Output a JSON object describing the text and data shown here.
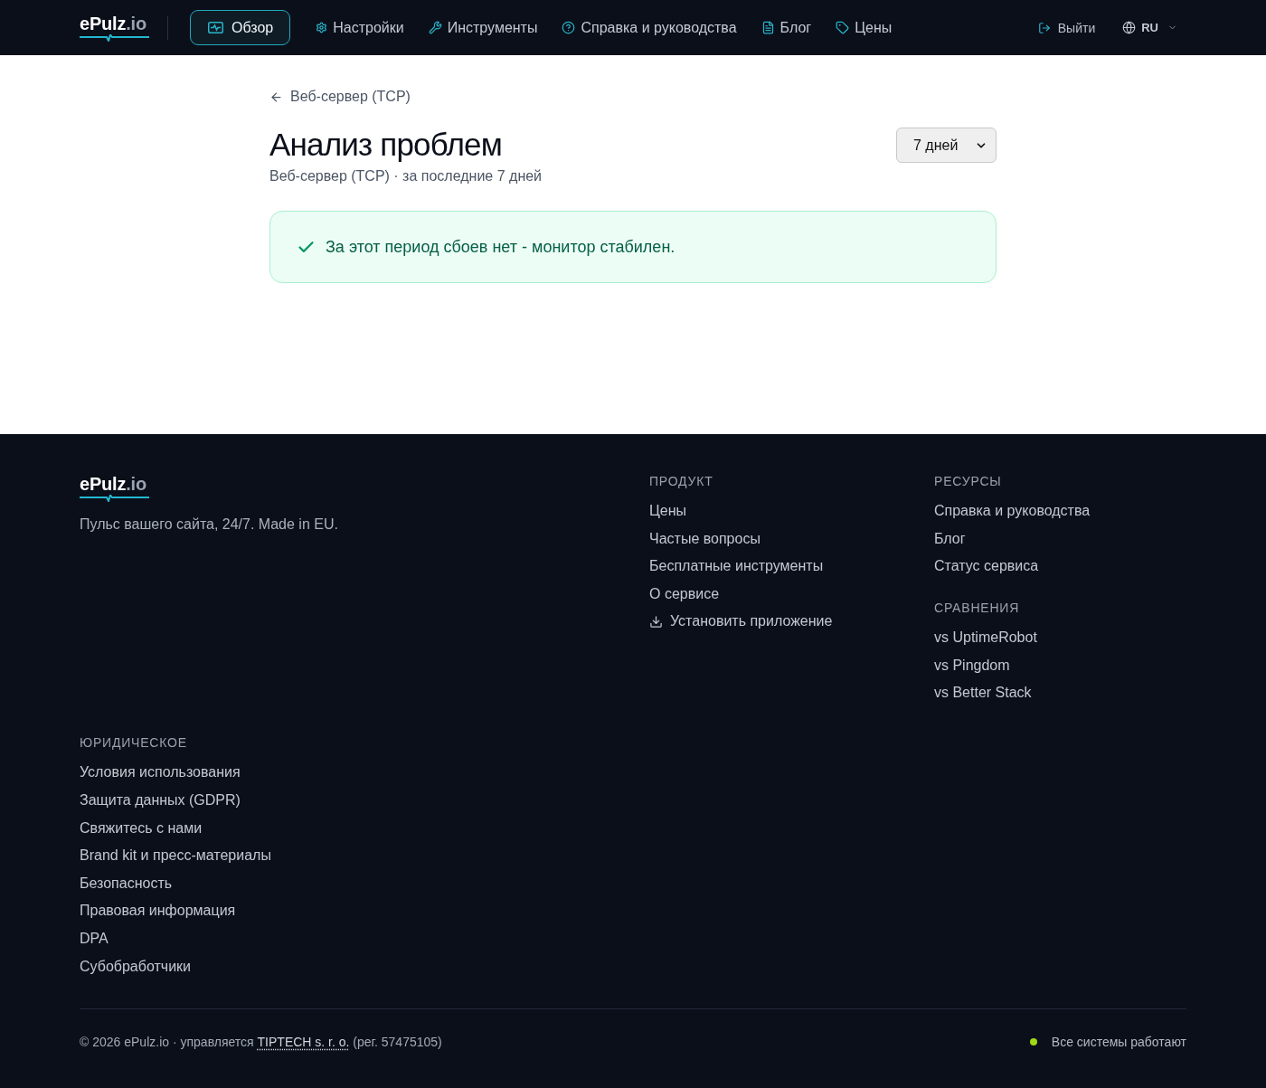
{
  "header": {
    "logo": {
      "name": "ePulz",
      "suffix": ".io"
    },
    "nav": [
      {
        "label": "Обзор",
        "selected": true
      },
      {
        "label": "Настройки",
        "selected": false
      },
      {
        "label": "Инструменты",
        "selected": false
      },
      {
        "label": "Справка и руководства",
        "selected": false
      },
      {
        "label": "Блог",
        "selected": false
      },
      {
        "label": "Цены",
        "selected": false
      }
    ],
    "logout": {
      "label": "Выйти"
    },
    "language": {
      "label": "RU"
    }
  },
  "page": {
    "back_link": "Веб-сервер (TCP)",
    "title": "Анализ проблем",
    "subtitle": "Веб-сервер (TCP) · за последние 7 дней",
    "period_select": {
      "value": "7 дней"
    },
    "alert": {
      "kind": "success",
      "text": "За этот период сбоев нет - монитор стабилен."
    }
  },
  "footer": {
    "logo": {
      "name": "ePulz",
      "suffix": ".io"
    },
    "tagline": "Пульс вашего сайта, 24/7. Made in EU.",
    "product": {
      "heading": "ПРОДУКТ",
      "links": [
        {
          "kind": "link",
          "label": "Цены"
        },
        {
          "kind": "link",
          "label": "Частые вопросы"
        },
        {
          "kind": "link",
          "label": "Бесплатные инструменты"
        },
        {
          "kind": "link",
          "label": "О сервисе"
        },
        {
          "kind": "install",
          "label": "Установить приложение"
        }
      ]
    },
    "resources": [
      {
        "heading": "РЕСУРСЫ",
        "links": [
          "Справка и руководства",
          "Блог",
          "Статус сервиса"
        ]
      },
      {
        "heading": "СРАВНЕНИЯ",
        "links": [
          "vs UptimeRobot",
          "vs Pingdom",
          "vs Better Stack"
        ]
      }
    ],
    "legal": {
      "heading": "ЮРИДИЧЕСКОЕ",
      "links": [
        "Условия использования",
        "Защита данных (GDPR)",
        "Свяжитесь с нами",
        "Brand kit и пресс-материалы",
        "Безопасность",
        "Правовая информация",
        "DPA",
        "Субобработчики"
      ]
    },
    "copyright": {
      "before": "© 2026 ePulz.io · управляется",
      "link": "TIPTECH s. r. o.",
      "after": "(рег. 57475105)"
    },
    "status": {
      "operational": true,
      "text": "Все системы работают"
    }
  }
}
